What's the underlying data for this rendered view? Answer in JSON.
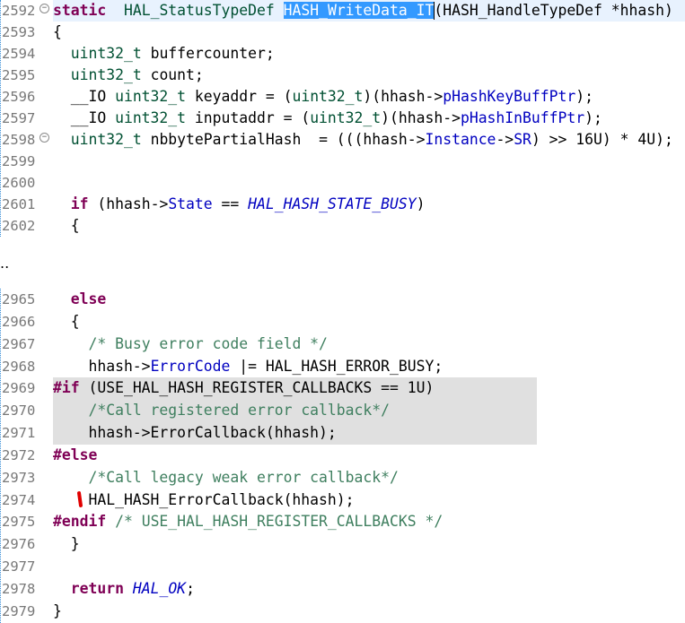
{
  "top_lines": [
    {
      "num": "2592",
      "fold": true,
      "current": true,
      "tokens": [
        [
          "kw",
          "static"
        ],
        [
          "",
          "  "
        ],
        [
          "ty",
          "HAL_StatusTypeDef"
        ],
        [
          "",
          " "
        ],
        [
          "sel",
          "HASH_WriteData_IT"
        ],
        [
          "",
          "(HASH_HandleTypeDef *hhash)"
        ]
      ]
    },
    {
      "num": "2593",
      "tokens": [
        [
          "",
          "{"
        ]
      ]
    },
    {
      "num": "2594",
      "tokens": [
        [
          "",
          "  "
        ],
        [
          "ty",
          "uint32_t"
        ],
        [
          "",
          " buffercounter;"
        ]
      ]
    },
    {
      "num": "2595",
      "tokens": [
        [
          "",
          "  "
        ],
        [
          "ty",
          "uint32_t"
        ],
        [
          "",
          " count;"
        ]
      ]
    },
    {
      "num": "2596",
      "tokens": [
        [
          "",
          "  __IO "
        ],
        [
          "ty",
          "uint32_t"
        ],
        [
          "",
          " keyaddr = ("
        ],
        [
          "ty",
          "uint32_t"
        ],
        [
          "",
          ")(hhash->"
        ],
        [
          "fld",
          "pHashKeyBuffPtr"
        ],
        [
          "",
          ");"
        ]
      ]
    },
    {
      "num": "2597",
      "tokens": [
        [
          "",
          "  __IO "
        ],
        [
          "ty",
          "uint32_t"
        ],
        [
          "",
          " inputaddr = ("
        ],
        [
          "ty",
          "uint32_t"
        ],
        [
          "",
          ")(hhash->"
        ],
        [
          "fld",
          "pHashInBuffPtr"
        ],
        [
          "",
          ");"
        ]
      ]
    },
    {
      "num": "2598",
      "fold": true,
      "tokens": [
        [
          "",
          "  "
        ],
        [
          "ty",
          "uint32_t"
        ],
        [
          "",
          " nbbytePartialHash  = (((hhash->"
        ],
        [
          "fld",
          "Instance"
        ],
        [
          "",
          "->"
        ],
        [
          "fld",
          "SR"
        ],
        [
          "",
          ") >> 16U) * 4U);"
        ]
      ]
    },
    {
      "num": "2599",
      "tokens": []
    },
    {
      "num": "2600",
      "tokens": []
    },
    {
      "num": "2601",
      "tokens": [
        [
          "",
          "  "
        ],
        [
          "kw",
          "if"
        ],
        [
          "",
          " (hhash->"
        ],
        [
          "fld",
          "State"
        ],
        [
          "",
          " == "
        ],
        [
          "en",
          "HAL_HASH_STATE_BUSY"
        ],
        [
          "",
          ")"
        ]
      ]
    },
    {
      "num": "2602",
      "tokens": [
        [
          "",
          "  {"
        ]
      ]
    }
  ],
  "ellipsis": "..",
  "bottom_lines": [
    {
      "num": "2965",
      "tokens": [
        [
          "",
          "  "
        ],
        [
          "kw",
          "else"
        ]
      ]
    },
    {
      "num": "2966",
      "tokens": [
        [
          "",
          "  {"
        ]
      ]
    },
    {
      "num": "2967",
      "tokens": [
        [
          "",
          "    "
        ],
        [
          "cm",
          "/* Busy error code field */"
        ]
      ]
    },
    {
      "num": "2968",
      "tokens": [
        [
          "",
          "    hhash->"
        ],
        [
          "fld",
          "ErrorCode"
        ],
        [
          "",
          " |= HAL_HASH_ERROR_BUSY;"
        ]
      ]
    },
    {
      "num": "2969",
      "inactive": true,
      "tokens": [
        [
          "kw",
          "#if"
        ],
        [
          "",
          " (USE_HAL_HASH_REGISTER_CALLBACKS == 1U)"
        ]
      ]
    },
    {
      "num": "2970",
      "inactive": true,
      "tokens": [
        [
          "",
          "    "
        ],
        [
          "cm",
          "/*Call registered error callback*/"
        ]
      ]
    },
    {
      "num": "2971",
      "inactive": true,
      "tokens": [
        [
          "",
          "    hhash->ErrorCallback(hhash);"
        ]
      ]
    },
    {
      "num": "2972",
      "tokens": [
        [
          "kw",
          "#else"
        ]
      ]
    },
    {
      "num": "2973",
      "tokens": [
        [
          "",
          "    "
        ],
        [
          "cm",
          "/*Call legacy weak error callback*/"
        ]
      ]
    },
    {
      "num": "2974",
      "tokens": [
        [
          "",
          "    HAL_HASH_ErrorCallback(hhash);"
        ]
      ]
    },
    {
      "num": "2975",
      "tokens": [
        [
          "kw",
          "#endif"
        ],
        [
          "",
          " "
        ],
        [
          "cm",
          "/* USE_HAL_HASH_REGISTER_CALLBACKS */"
        ]
      ]
    },
    {
      "num": "2976",
      "tokens": [
        [
          "",
          "  }"
        ]
      ]
    },
    {
      "num": "2977",
      "tokens": []
    },
    {
      "num": "2978",
      "tokens": [
        [
          "",
          "  "
        ],
        [
          "kw",
          "return"
        ],
        [
          "",
          " "
        ],
        [
          "en",
          "HAL_OK"
        ],
        [
          "",
          ";"
        ]
      ]
    },
    {
      "num": "2979",
      "tokens": [
        [
          "",
          "}"
        ]
      ]
    }
  ],
  "colors": {
    "keyword": "#7f0055",
    "type": "#005032",
    "field": "#0000c0",
    "comment": "#3f7f5f",
    "selection": "#3399ff",
    "inactive_bg": "#e0e0e0",
    "current_line": "#e8f2fe"
  },
  "icons": {
    "fold": "collapse-fold-icon"
  }
}
